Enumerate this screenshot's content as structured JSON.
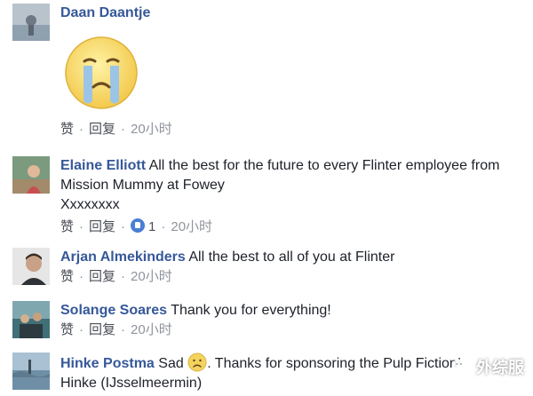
{
  "actions": {
    "like": "赞",
    "reply": "回复",
    "separator": "·"
  },
  "comments": [
    {
      "name": "Daan Daantje",
      "text": "",
      "emoji": "crying-face",
      "time": "20小时"
    },
    {
      "name": "Elaine Elliott",
      "text": "All the best for the future to every Flinter employee from Mission Mummy at Fowey",
      "text2": "Xxxxxxxx",
      "like_count": "1",
      "time": "20小时"
    },
    {
      "name": "Arjan Almekinders",
      "text": "All the best to all of you at Flinter",
      "time": "20小时"
    },
    {
      "name": "Solange Soares",
      "text": "Thank you for everything!",
      "time": "20小时"
    },
    {
      "name": "Hinke Postma",
      "text_before_emoji": "Sad",
      "text_after_emoji": ". Thanks for sponsoring the Pulp Fiction!",
      "text2": "Hinke (IJsselmeermin)"
    }
  ],
  "watermark": {
    "text": "外综服"
  },
  "colors": {
    "name": "#365899",
    "text": "#1d2129",
    "meta": "#90949c",
    "like_badge": "#4a7fd3"
  }
}
